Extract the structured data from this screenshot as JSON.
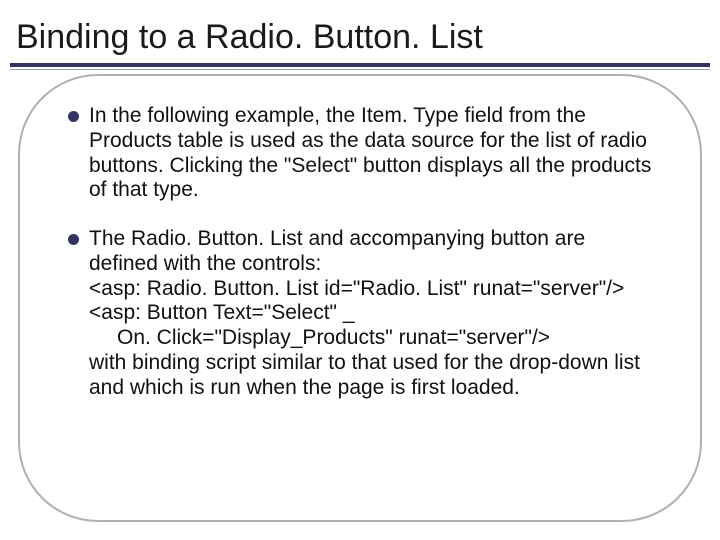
{
  "slide": {
    "title": "Binding to a Radio. Button. List",
    "bullets": [
      {
        "text": "In the following example, the Item. Type field from the Products table is used as the data source for the list of radio buttons. Clicking the \"Select\" button displays all the products of that type."
      },
      {
        "intro": "The Radio. Button. List and accompanying button are defined with the controls:",
        "code_line1": "<asp: Radio. Button. List id=\"Radio. List\" runat=\"server\"/>",
        "code_line2": "<asp: Button Text=\"Select\" _",
        "code_line3": "On. Click=\"Display_Products\" runat=\"server\"/>",
        "outro": "with binding script similar to that used for the drop-down list and which is run when the page is first loaded."
      }
    ]
  }
}
